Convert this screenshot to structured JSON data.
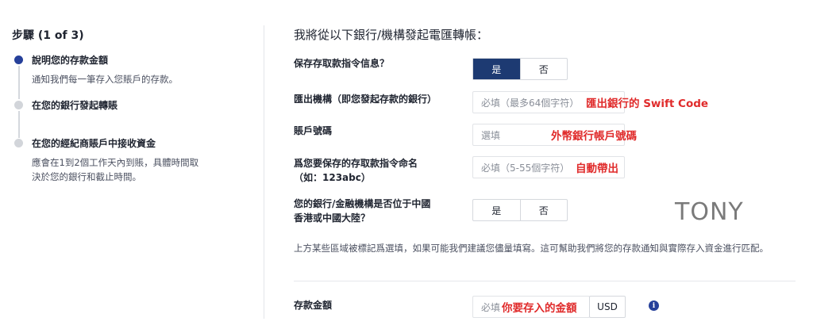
{
  "stepper": {
    "title": "步驟 (1 of 3)",
    "steps": [
      {
        "label": "說明您的存款金額",
        "desc": "通知我們每一筆存入您賬戶的存款。",
        "state": "active"
      },
      {
        "label": "在您的銀行發起轉賬",
        "desc": "",
        "state": "inactive"
      },
      {
        "label": "在您的經紀商賬戶中接收資金",
        "desc_lines": [
          "應會在1到2個工作天內到賬，具體時間取",
          "決於您的銀行和截止時間。"
        ],
        "state": "inactive"
      }
    ]
  },
  "form": {
    "heading": "我將從以下銀行/機構發起電匯轉帳：",
    "save_instructions": {
      "label": "保存存取款指令信息？",
      "yes": "是",
      "no": "否",
      "selected": "yes"
    },
    "sending_institution": {
      "label": "匯出機構（即您發起存款的銀行）",
      "placeholder": "必填（最多64個字符）",
      "note": "匯出銀行的 Swift Code"
    },
    "account_number": {
      "label": "賬戶號碼",
      "placeholder": "選填",
      "note": "外幣銀行帳戶號碼"
    },
    "instruction_name": {
      "label_lines": [
        "爲您要保存的存取款指令命名",
        "（如：123abc）"
      ],
      "placeholder": "必填（5-55個字符）",
      "note": "自動帶出"
    },
    "in_china": {
      "label_lines": [
        "您的銀行/金融機構是否位于中國",
        "香港或中國大陸？"
      ],
      "yes": "是",
      "no": "否",
      "selected": "none"
    },
    "helper_text": "上方某些區域被標記爲選填，如果可能我們建議您儘量填寫。這可幫助我們將您的存款通知與實際存入資金進行匹配。",
    "amount": {
      "label": "存款金額",
      "placeholder": "必填",
      "note": "你要存入的金額",
      "currency": "USD"
    }
  },
  "watermark": "TONY",
  "colors": {
    "primary": "#1d3a72",
    "accent_dot": "#26409a",
    "annotation_red": "#e02b2b"
  },
  "icons": {
    "info": "info-icon"
  }
}
